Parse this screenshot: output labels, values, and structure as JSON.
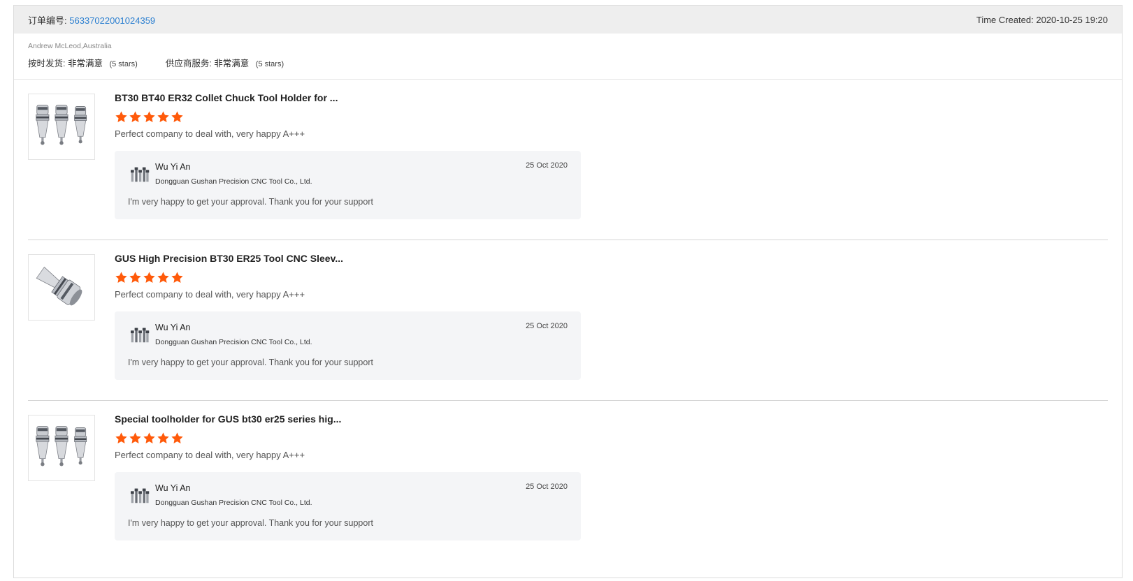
{
  "order": {
    "label": "订单编号:",
    "number": "56337022001024359",
    "time_created": "Time Created: 2020-10-25 19:20"
  },
  "buyer": {
    "name": "Andrew McLeod,Australia",
    "ratings": [
      {
        "label": "按时发货:",
        "value": "非常满意",
        "stars_text": "(5 stars)",
        "stars": 5
      },
      {
        "label": "供应商服务:",
        "value": "非常满意",
        "stars_text": "(5 stars)",
        "stars": 5
      }
    ]
  },
  "star_color": "#ff5a0a",
  "items": [
    {
      "title": "BT30 BT40 ER32 Collet Chuck Tool Holder for ...",
      "rating": 5,
      "comment": "Perfect company to deal with, very happy A+++",
      "thumb_icon": "three-tool-holders-icon",
      "reply": {
        "name": "Wu Yi An",
        "company": "Dongguan Gushan Precision CNC Tool Co., Ltd.",
        "date": "25 Oct 2020",
        "text": "I'm very happy to get your approval. Thank you for your support"
      }
    },
    {
      "title": "GUS High Precision BT30 ER25 Tool CNC Sleev...",
      "rating": 5,
      "comment": "Perfect company to deal with, very happy A+++",
      "thumb_icon": "single-tool-holder-icon",
      "reply": {
        "name": "Wu Yi An",
        "company": "Dongguan Gushan Precision CNC Tool Co., Ltd.",
        "date": "25 Oct 2020",
        "text": "I'm very happy to get your approval. Thank you for your support"
      }
    },
    {
      "title": "Special toolholder for GUS bt30 er25 series hig...",
      "rating": 5,
      "comment": "Perfect company to deal with, very happy A+++",
      "thumb_icon": "three-tool-holders-icon",
      "reply": {
        "name": "Wu Yi An",
        "company": "Dongguan Gushan Precision CNC Tool Co., Ltd.",
        "date": "25 Oct 2020",
        "text": "I'm very happy to get your approval. Thank you for your support"
      }
    }
  ]
}
